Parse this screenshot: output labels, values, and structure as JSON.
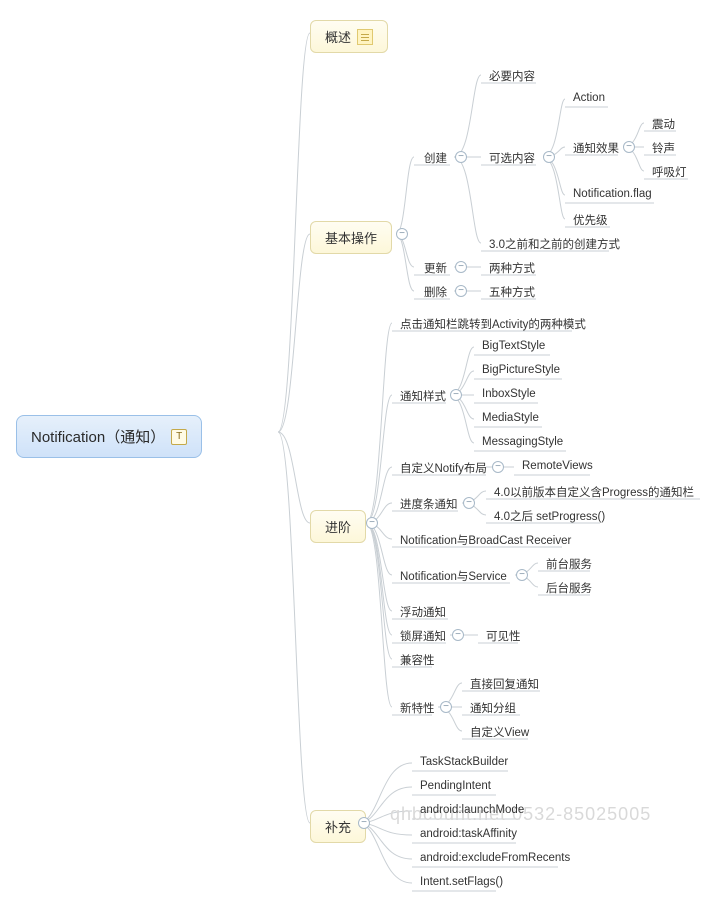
{
  "root": {
    "label": "Notification（通知）",
    "icon": "T"
  },
  "branches": {
    "overview": "概述",
    "basic": "基本操作",
    "advanced": "进阶",
    "supplement": "补充"
  },
  "basic": {
    "create": "创建",
    "update": "更新",
    "delete": "删除",
    "required": "必要内容",
    "optional": "可选内容",
    "oldway": "3.0之前和之前的创建方式",
    "action": "Action",
    "effect": "通知效果",
    "flag": "Notification.flag",
    "priority": "优先级",
    "vibrate": "震动",
    "ring": "铃声",
    "led": "呼吸灯",
    "update_opt": "两种方式",
    "delete_opt": "五种方式"
  },
  "advanced": {
    "click_modes": "点击通知栏跳转到Activity的两种模式",
    "style": "通知样式",
    "styles": {
      "big_text": "BigTextStyle",
      "big_pic": "BigPictureStyle",
      "inbox": "InboxStyle",
      "media": "MediaStyle",
      "messaging": "MessagingStyle"
    },
    "custom_layout": "自定义Notify布局",
    "remote_views": "RemoteViews",
    "progress": "进度条通知",
    "progress_old": "4.0以前版本自定义含Progress的通知栏",
    "progress_new": "4.0之后 setProgress()",
    "broadcast": "Notification与BroadCast Receiver",
    "service": "Notification与Service",
    "foreground": "前台服务",
    "background": "后台服务",
    "headsup": "浮动通知",
    "lockscreen": "锁屏通知",
    "visibility": "可见性",
    "compat": "兼容性",
    "new_features": "新特性",
    "direct_reply": "直接回复通知",
    "grouping": "通知分组",
    "custom_view": "自定义View"
  },
  "supplement": {
    "items": [
      "TaskStackBuilder",
      "PendingIntent",
      "android:launchMode",
      "android:taskAffinity",
      "android:excludeFromRecents",
      "Intent.setFlags()"
    ]
  },
  "watermark": "qhbcount.net 0532-85025005"
}
